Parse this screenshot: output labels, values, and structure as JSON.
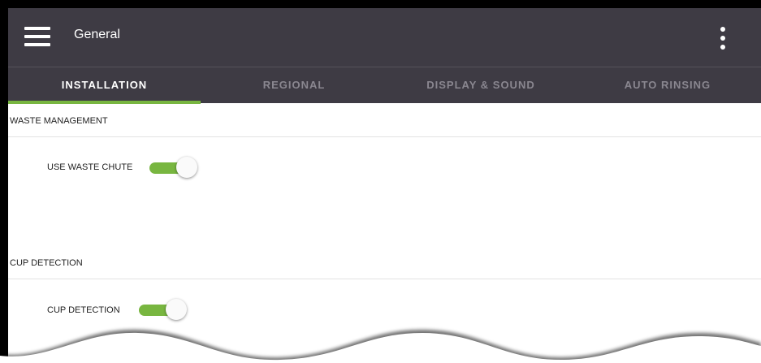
{
  "header": {
    "title": "General",
    "menu_icon": "hamburger-menu-icon",
    "more_icon": "more-vert-icon"
  },
  "tabs": [
    {
      "label": "INSTALLATION",
      "active": true
    },
    {
      "label": "REGIONAL",
      "active": false
    },
    {
      "label": "DISPLAY & SOUND",
      "active": false
    },
    {
      "label": "AUTO RINSING",
      "active": false
    }
  ],
  "sections": {
    "waste_management": {
      "title": "WASTE MANAGEMENT",
      "setting_label": "USE WASTE CHUTE",
      "enabled": true
    },
    "cup_detection": {
      "title": "CUP DETECTION",
      "setting_label": "CUP DETECTION",
      "enabled": true
    }
  },
  "colors": {
    "toolbar": "#3e3b44",
    "accent": "#78b640",
    "inactive_tab_text": "#8a8790"
  }
}
